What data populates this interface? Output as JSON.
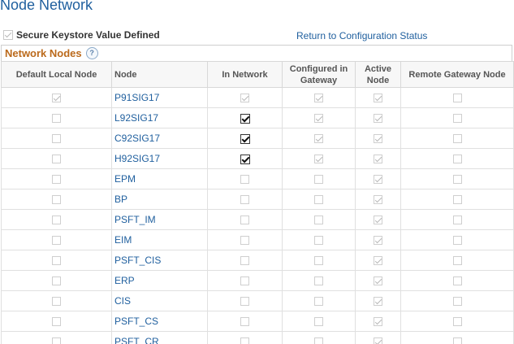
{
  "page": {
    "title": "Node Network",
    "keystore_label": "Secure Keystore Value Defined",
    "keystore_checked": true,
    "return_link": "Return to Configuration Status"
  },
  "grid": {
    "title": "Network Nodes",
    "help_icon": "help-icon",
    "columns": [
      "Default Local Node",
      "Node",
      "In Network",
      "Configured in Gateway",
      "Active Node",
      "Remote Gateway Node"
    ],
    "rows": [
      {
        "node": "P91SIG17",
        "default_local": true,
        "in_network": true,
        "in_network_editable": false,
        "configured": true,
        "active": true,
        "remote": false
      },
      {
        "node": "L92SIG17",
        "default_local": false,
        "in_network": true,
        "in_network_editable": true,
        "configured": true,
        "active": true,
        "remote": false
      },
      {
        "node": "C92SIG17",
        "default_local": false,
        "in_network": true,
        "in_network_editable": true,
        "configured": true,
        "active": true,
        "remote": false
      },
      {
        "node": "H92SIG17",
        "default_local": false,
        "in_network": true,
        "in_network_editable": true,
        "configured": true,
        "active": true,
        "remote": false
      },
      {
        "node": "EPM",
        "default_local": false,
        "in_network": false,
        "in_network_editable": false,
        "configured": false,
        "active": true,
        "remote": false
      },
      {
        "node": "BP",
        "default_local": false,
        "in_network": false,
        "in_network_editable": false,
        "configured": false,
        "active": true,
        "remote": false
      },
      {
        "node": "PSFT_IM",
        "default_local": false,
        "in_network": false,
        "in_network_editable": false,
        "configured": false,
        "active": true,
        "remote": false
      },
      {
        "node": "EIM",
        "default_local": false,
        "in_network": false,
        "in_network_editable": false,
        "configured": false,
        "active": true,
        "remote": false
      },
      {
        "node": "PSFT_CIS",
        "default_local": false,
        "in_network": false,
        "in_network_editable": false,
        "configured": false,
        "active": true,
        "remote": false
      },
      {
        "node": "ERP",
        "default_local": false,
        "in_network": false,
        "in_network_editable": false,
        "configured": false,
        "active": true,
        "remote": false
      },
      {
        "node": "CIS",
        "default_local": false,
        "in_network": false,
        "in_network_editable": false,
        "configured": false,
        "active": true,
        "remote": false
      },
      {
        "node": "PSFT_CS",
        "default_local": false,
        "in_network": false,
        "in_network_editable": false,
        "configured": false,
        "active": true,
        "remote": false
      },
      {
        "node": "PSFT_CR",
        "default_local": false,
        "in_network": false,
        "in_network_editable": false,
        "configured": false,
        "active": true,
        "remote": false
      }
    ]
  }
}
